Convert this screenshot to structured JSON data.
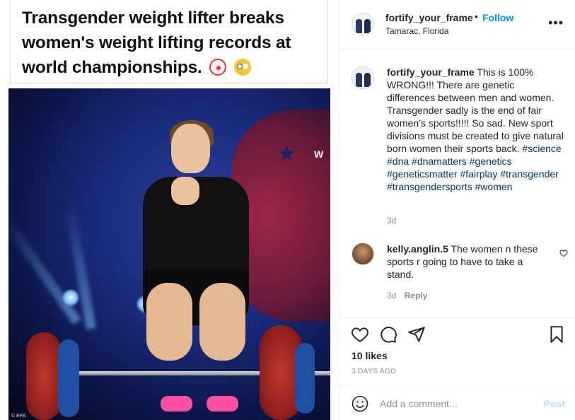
{
  "post_image": {
    "headline": "Transgender weight lifter breaks women's weight lifting records at world championships.",
    "emojis": [
      "clown-face-emoji",
      "flushed-face-emoji"
    ],
    "photo_credit": "© EPA",
    "background_text": "W"
  },
  "header": {
    "username": "fortify_your_frame",
    "separator": "•",
    "follow_label": "Follow",
    "location": "Tamarac, Florida",
    "more_icon": "more-horizontal-icon"
  },
  "comments": [
    {
      "username": "fortify_your_frame",
      "text": "This is 100% WRONG!!! There are genetic differences between men and women. Transgender sadly is the end of fair women’s sports!!!!! So sad. New sport divisions must be created to give natural born women their sports back.",
      "hashtags": "#science #dna #dnamatters #genetics #geneticsmatter #fairplay #transgender #transgendersports #women",
      "time": "3d"
    },
    {
      "username": "kelly.anglin.5",
      "text": "The women n these sports r going to have to take a stand.",
      "time": "3d",
      "reply_label": "Reply"
    }
  ],
  "actions": {
    "like_icon": "heart-icon",
    "comment_icon": "comment-icon",
    "share_icon": "paper-plane-icon",
    "save_icon": "bookmark-icon",
    "likes": "10 likes",
    "time_ago": "3 DAYS AGO"
  },
  "add_comment": {
    "placeholder": "Add a comment...",
    "post_label": "Post",
    "emoji_icon": "smiley-icon"
  },
  "colors": {
    "link_blue": "#0095f6",
    "hashtag_blue": "#00376b",
    "muted": "#8e8e8e",
    "post_disabled": "#b2dffc"
  }
}
